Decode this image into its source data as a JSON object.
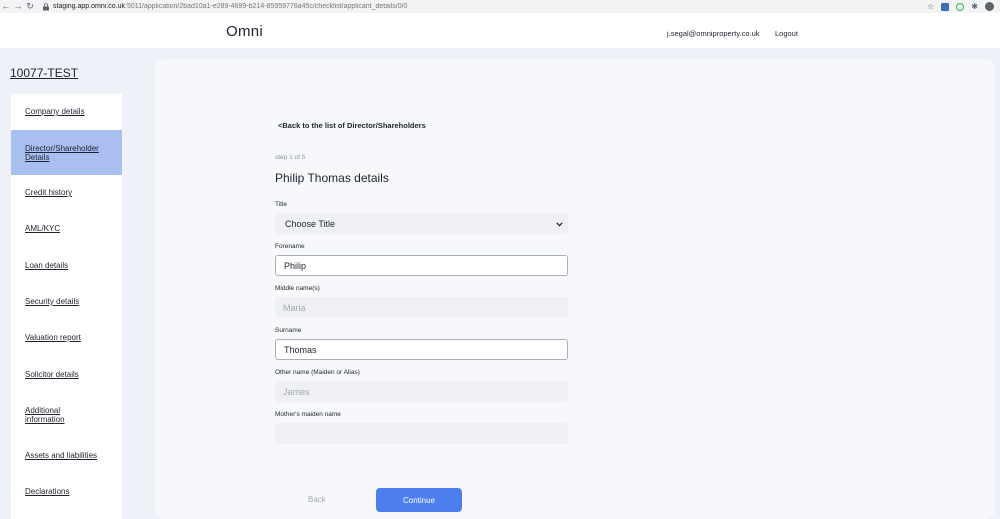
{
  "browser": {
    "url_host": "staging.app.omni.co.uk",
    "url_path": ":5011/application/2bad10a1-e289-4699-b214-85959776a45c/checklist/applicant_details/0/0"
  },
  "header": {
    "brand": "Omni",
    "user_email": "j.segal@omniproperty.co.uk",
    "logout_label": "Logout"
  },
  "sidebar": {
    "application_ref": "10077-TEST",
    "items": [
      {
        "label": "Company details"
      },
      {
        "label": "Director/Shareholder Details"
      },
      {
        "label": "Credit history"
      },
      {
        "label": "AML/KYC"
      },
      {
        "label": "Loan details"
      },
      {
        "label": "Security details"
      },
      {
        "label": "Valuation report"
      },
      {
        "label": "Solicitor details"
      },
      {
        "label": "Additional information"
      },
      {
        "label": "Assets and liabilities"
      },
      {
        "label": "Declarations"
      }
    ],
    "active_index": 1
  },
  "form": {
    "back_link": "<Back to the list of Director/Shareholders",
    "step": "step 1 of 5",
    "title": "Philip Thomas details",
    "fields": {
      "title": {
        "label": "Title",
        "value": "Choose Title"
      },
      "forename": {
        "label": "Forename",
        "value": "Philip"
      },
      "middle_name": {
        "label": "Middle name(s)",
        "placeholder": "Maria"
      },
      "surname": {
        "label": "Surname",
        "value": "Thomas"
      },
      "other_name": {
        "label": "Other name (Maiden or Alias)",
        "placeholder": "James"
      },
      "mothers_maiden": {
        "label": "Mother's maiden name",
        "placeholder": ""
      }
    },
    "back_button": "Back",
    "continue_button": "Continue"
  },
  "colors": {
    "accent": "#4d7ef0",
    "active_nav": "#a8bff0",
    "page_bg": "#eef1f7"
  }
}
